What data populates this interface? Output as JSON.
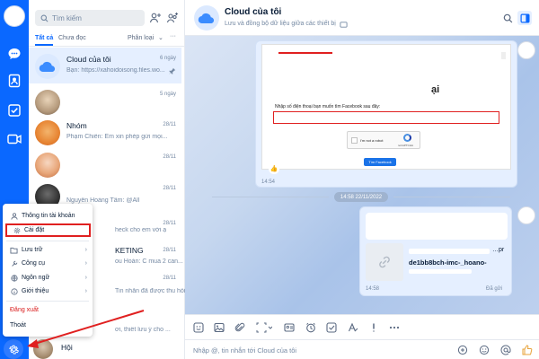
{
  "search": {
    "placeholder": "Tìm kiếm"
  },
  "tabs": {
    "all": "Tất cả",
    "unread": "Chưa đọc",
    "classify": "Phân loại"
  },
  "conversations": [
    {
      "name": "Cloud của tôi",
      "preview": "Bạn: https://xahoidoisong.files.wo...",
      "time": "6 ngày",
      "selected": true
    },
    {
      "name": "",
      "preview": "",
      "time": "5 ngày"
    },
    {
      "name": "Nhóm",
      "preview": "Phạm Chiến: Em xin phép gửi mọi...",
      "time": "28/11"
    },
    {
      "name": "",
      "preview": "",
      "time": "28/11"
    },
    {
      "name": "",
      "preview": "Nguyễn Hoàng Tâm: @All",
      "time": "28/11"
    },
    {
      "name": "",
      "preview": "heck cho em với ạ",
      "time": "28/11"
    },
    {
      "name": "KETING",
      "preview": "ou Hoàn: C mua 2 can...",
      "time": "28/11"
    },
    {
      "name": "",
      "preview": "Tin nhắn đã được thu hồi",
      "time": "28/11"
    },
    {
      "name": "",
      "preview": "",
      "time": ""
    },
    {
      "name": "Hội",
      "preview": "ơi, thiết lưu ý cho ...",
      "time": ""
    }
  ],
  "menu": {
    "account": "Thông tin tài khoản",
    "settings": "Cài đặt",
    "storage": "Lưu trữ",
    "tools": "Công cụ",
    "language": "Ngôn ngữ",
    "about": "Giới thiệu",
    "logout": "Đăng xuất",
    "quit": "Thoát"
  },
  "chat": {
    "title": "Cloud của tôi",
    "subtitle": "Lưu và đồng bộ dữ liệu giữa các thiết bị",
    "screenshot": {
      "heading": "ại",
      "prompt": "Nhập số điện thoại bạn muốn tìm Facebook sau đây:",
      "captcha": "I'm not a robot",
      "captcha_brand": "reCAPTCHA",
      "button": "Tìm Facebook"
    },
    "msg1_time": "14:54",
    "date_separator": "14:58 22/11/2022",
    "link_title_frag": "…pr",
    "link_url": "de1bb8bch-imc-_hoano-",
    "msg2_time": "14:58",
    "msg2_status": "Đã gửi"
  },
  "composer": {
    "placeholder": "Nhập @, tin nhắn tới Cloud của tôi"
  },
  "colors": {
    "accent": "#0a68ff",
    "highlight": "#e02020"
  }
}
